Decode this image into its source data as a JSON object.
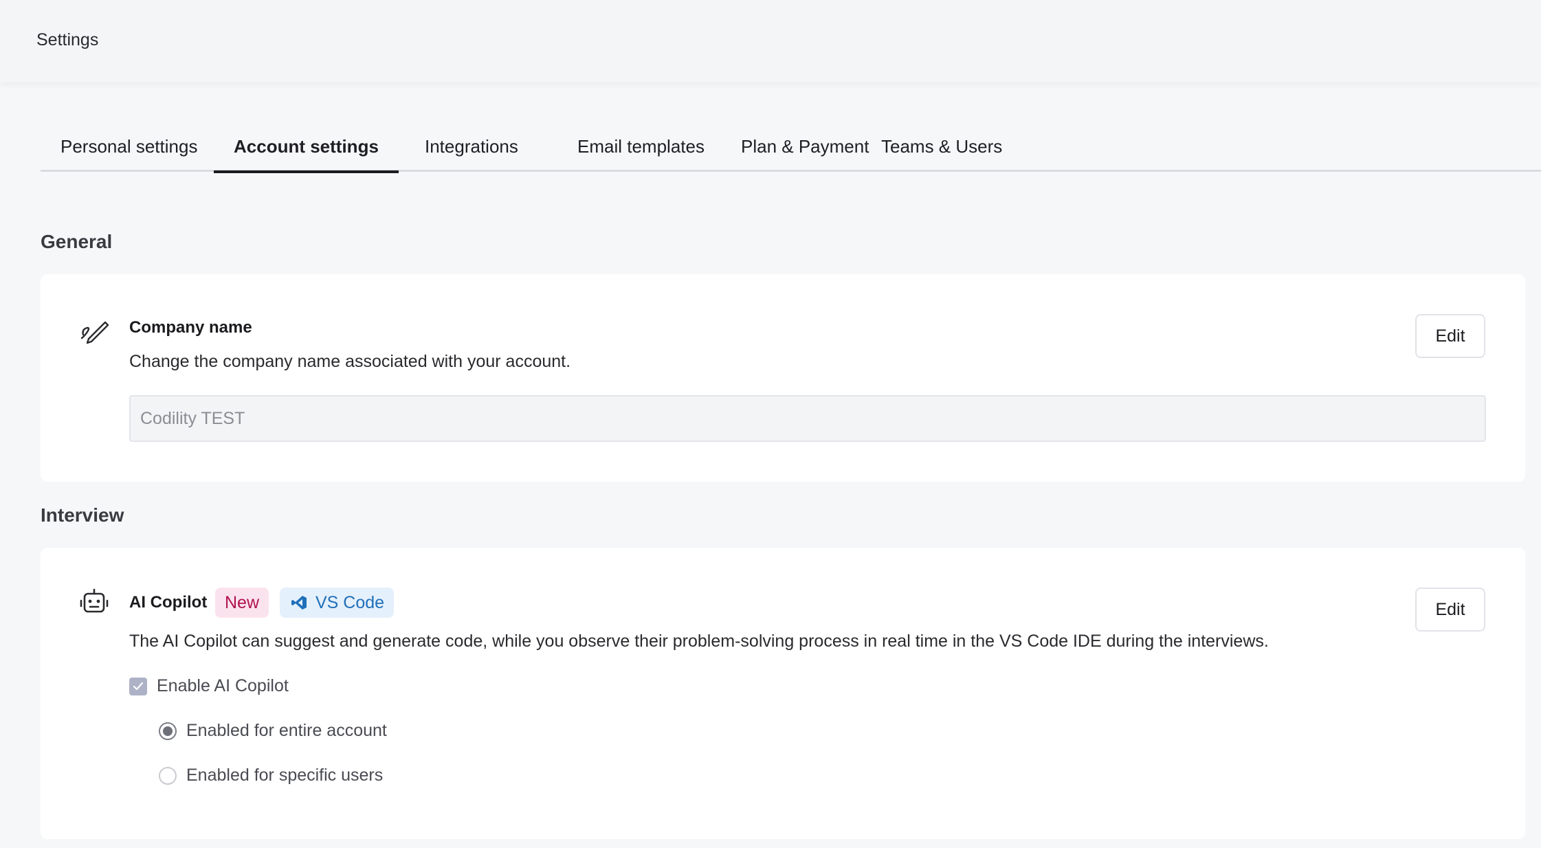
{
  "header": {
    "title": "Settings"
  },
  "tabs": [
    {
      "label": "Personal settings",
      "active": false
    },
    {
      "label": "Account settings",
      "active": true
    },
    {
      "label": "Integrations",
      "active": false
    },
    {
      "label": "Email templates",
      "active": false
    },
    {
      "label": "Plan & Payment",
      "active": false
    },
    {
      "label": "Teams & Users",
      "active": false
    }
  ],
  "general": {
    "section_title": "General",
    "company": {
      "icon": "signature-icon",
      "title": "Company name",
      "description": "Change the company name associated with your account.",
      "value": "Codility TEST",
      "edit_label": "Edit"
    }
  },
  "interview": {
    "section_title": "Interview",
    "copilot": {
      "icon": "robot-icon",
      "title": "AI Copilot",
      "badge_new": "New",
      "badge_vscode": "VS Code",
      "description": "The AI Copilot can suggest and generate code, while you observe their problem-solving process in real time in the VS Code IDE during the interviews.",
      "edit_label": "Edit",
      "enable_label": "Enable AI Copilot",
      "enable_checked": true,
      "options": [
        {
          "label": "Enabled for entire account",
          "checked": true
        },
        {
          "label": "Enabled for specific users",
          "checked": false
        }
      ]
    }
  },
  "colors": {
    "accent_new": "#b0124f",
    "accent_vscode": "#1f6fba",
    "page_background": "#f6f7f9"
  }
}
